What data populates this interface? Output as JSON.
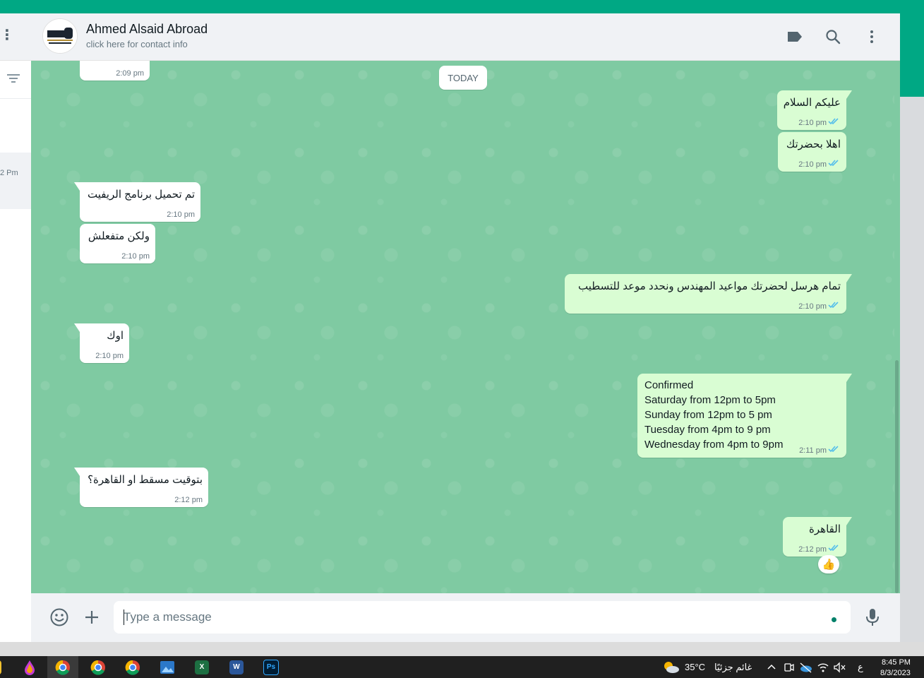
{
  "colors": {
    "accent": "#00a884",
    "chat_background": "#7fcaa2",
    "incoming_bubble": "#ffffff",
    "outgoing_bubble": "#d9fdd3",
    "read_ticks": "#53bdeb",
    "taskbar": "#202020"
  },
  "sidebar": {
    "menu_icon": "dots-vertical-icon",
    "filter_icon": "filter-icon",
    "partial_time": "2 Pm"
  },
  "header": {
    "avatar_text": "ABROAD",
    "contact_name": "Ahmed Alsaid Abroad",
    "contact_subtitle": "click here for contact info",
    "icons": [
      "label-icon",
      "search-icon",
      "menu-icon"
    ]
  },
  "chat": {
    "date_divider": "TODAY",
    "messages": [
      {
        "dir": "in",
        "text": "",
        "time": "2:09 pm"
      },
      {
        "dir": "out",
        "text": "عليكم السلام",
        "time": "2:10 pm",
        "status": "read"
      },
      {
        "dir": "out",
        "text": "اهلا بحضرتك",
        "time": "2:10 pm",
        "status": "read"
      },
      {
        "dir": "in",
        "text": "تم تحميل برنامج الريفيت",
        "time": "2:10 pm"
      },
      {
        "dir": "in",
        "text": "ولكن متفعلش",
        "time": "2:10 pm"
      },
      {
        "dir": "out",
        "text": "تمام هرسل لحضرتك مواعيد المهندس ونحدد موعد للتسطيب",
        "time": "2:10 pm",
        "status": "read"
      },
      {
        "dir": "in",
        "text": "اوك",
        "time": "2:10 pm"
      },
      {
        "dir": "out",
        "lines": [
          "Confirmed",
          "Saturday from 12pm to 5pm",
          "Sunday from 12pm to 5 pm",
          "Tuesday from 4pm to 9 pm",
          "Wednesday from 4pm to 9pm"
        ],
        "time": "2:11 pm",
        "status": "read"
      },
      {
        "dir": "in",
        "text": "بتوقيت مسقط او القاهرة؟",
        "time": "2:12 pm"
      },
      {
        "dir": "out",
        "text": "القاهرة",
        "time": "2:12 pm",
        "status": "read",
        "reaction": "👍"
      }
    ]
  },
  "composer": {
    "placeholder": "Type a message",
    "emoji_icon": "emoji-icon",
    "attach_icon": "plus-icon",
    "mic_icon": "mic-icon"
  },
  "taskbar": {
    "apps": [
      "file-explorer",
      "paint",
      "chrome",
      "chrome-profile-1",
      "chrome-profile-2",
      "photos",
      "excel",
      "word",
      "photoshop"
    ],
    "weather_temp": "35°C",
    "weather_text": "غائم جزئيًا",
    "language": "ع",
    "time": "8:45 PM",
    "date": "8/3/2023"
  }
}
